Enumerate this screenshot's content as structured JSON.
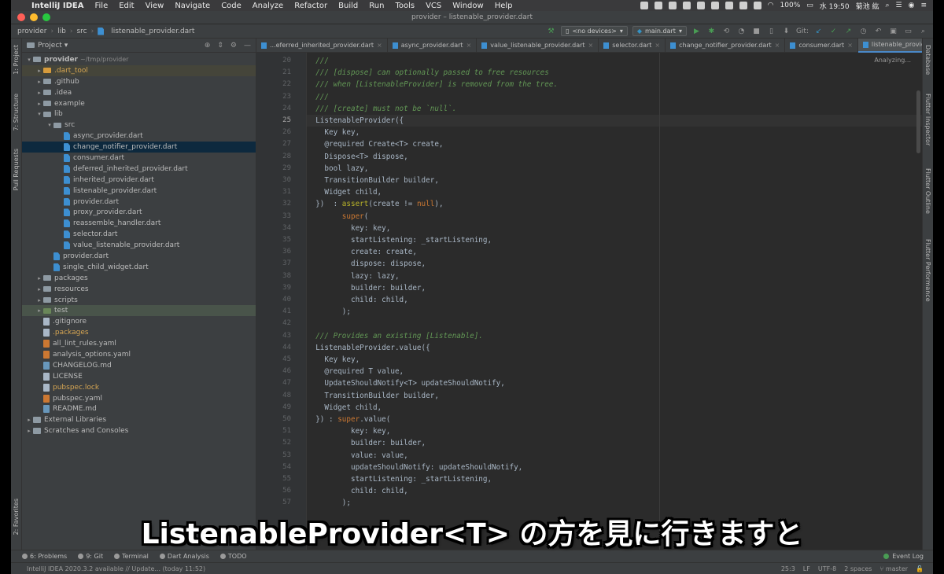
{
  "menubar": {
    "app": "IntelliJ IDEA",
    "items": [
      "File",
      "Edit",
      "View",
      "Navigate",
      "Code",
      "Analyze",
      "Refactor",
      "Build",
      "Run",
      "Tools",
      "VCS",
      "Window",
      "Help"
    ],
    "battery": "100%",
    "clock": "水 19:50",
    "user": "菊池 紘"
  },
  "window": {
    "title": "provider – listenable_provider.dart"
  },
  "breadcrumb": [
    "provider",
    "lib",
    "src",
    "listenable_provider.dart"
  ],
  "toolbar": {
    "device": "<no devices>",
    "run_config": "main.dart",
    "git_label": "Git:"
  },
  "project": {
    "header": "Project",
    "tree": [
      {
        "indent": 0,
        "arrow": "▾",
        "icon": "folder",
        "label": "provider",
        "suffix": "~/tmp/provider",
        "bold": true
      },
      {
        "indent": 1,
        "arrow": "▸",
        "icon": "folder-orange",
        "label": ".dart_tool",
        "style": "excluded"
      },
      {
        "indent": 1,
        "arrow": "▸",
        "icon": "folder",
        "label": ".github"
      },
      {
        "indent": 1,
        "arrow": "▸",
        "icon": "folder",
        "label": ".idea"
      },
      {
        "indent": 1,
        "arrow": "▸",
        "icon": "folder",
        "label": "example"
      },
      {
        "indent": 1,
        "arrow": "▾",
        "icon": "folder",
        "label": "lib"
      },
      {
        "indent": 2,
        "arrow": "▾",
        "icon": "folder",
        "label": "src"
      },
      {
        "indent": 3,
        "arrow": "",
        "icon": "dart",
        "label": "async_provider.dart"
      },
      {
        "indent": 3,
        "arrow": "",
        "icon": "dart",
        "label": "change_notifier_provider.dart",
        "style": "selected"
      },
      {
        "indent": 3,
        "arrow": "",
        "icon": "dart",
        "label": "consumer.dart"
      },
      {
        "indent": 3,
        "arrow": "",
        "icon": "dart",
        "label": "deferred_inherited_provider.dart"
      },
      {
        "indent": 3,
        "arrow": "",
        "icon": "dart",
        "label": "inherited_provider.dart"
      },
      {
        "indent": 3,
        "arrow": "",
        "icon": "dart",
        "label": "listenable_provider.dart"
      },
      {
        "indent": 3,
        "arrow": "",
        "icon": "dart",
        "label": "provider.dart"
      },
      {
        "indent": 3,
        "arrow": "",
        "icon": "dart",
        "label": "proxy_provider.dart"
      },
      {
        "indent": 3,
        "arrow": "",
        "icon": "dart",
        "label": "reassemble_handler.dart"
      },
      {
        "indent": 3,
        "arrow": "",
        "icon": "dart",
        "label": "selector.dart"
      },
      {
        "indent": 3,
        "arrow": "",
        "icon": "dart",
        "label": "value_listenable_provider.dart"
      },
      {
        "indent": 2,
        "arrow": "",
        "icon": "dart",
        "label": "provider.dart"
      },
      {
        "indent": 2,
        "arrow": "",
        "icon": "dart",
        "label": "single_child_widget.dart"
      },
      {
        "indent": 1,
        "arrow": "▸",
        "icon": "folder",
        "label": "packages"
      },
      {
        "indent": 1,
        "arrow": "▸",
        "icon": "folder",
        "label": "resources"
      },
      {
        "indent": 1,
        "arrow": "▸",
        "icon": "folder",
        "label": "scripts"
      },
      {
        "indent": 1,
        "arrow": "▸",
        "icon": "folder-green",
        "label": "test",
        "style": "test"
      },
      {
        "indent": 1,
        "arrow": "",
        "icon": "plain",
        "label": ".gitignore"
      },
      {
        "indent": 1,
        "arrow": "",
        "icon": "plain",
        "label": ".packages",
        "orange": true
      },
      {
        "indent": 1,
        "arrow": "",
        "icon": "yaml",
        "label": "all_lint_rules.yaml"
      },
      {
        "indent": 1,
        "arrow": "",
        "icon": "yaml",
        "label": "analysis_options.yaml"
      },
      {
        "indent": 1,
        "arrow": "",
        "icon": "md",
        "label": "CHANGELOG.md"
      },
      {
        "indent": 1,
        "arrow": "",
        "icon": "plain",
        "label": "LICENSE"
      },
      {
        "indent": 1,
        "arrow": "",
        "icon": "plain",
        "label": "pubspec.lock",
        "orange": true
      },
      {
        "indent": 1,
        "arrow": "",
        "icon": "yaml",
        "label": "pubspec.yaml"
      },
      {
        "indent": 1,
        "arrow": "",
        "icon": "md",
        "label": "README.md"
      },
      {
        "indent": 0,
        "arrow": "▸",
        "icon": "lib",
        "label": "External Libraries"
      },
      {
        "indent": 0,
        "arrow": "▸",
        "icon": "lib",
        "label": "Scratches and Consoles"
      }
    ]
  },
  "tabs": [
    {
      "label": "...eferred_inherited_provider.dart"
    },
    {
      "label": "async_provider.dart"
    },
    {
      "label": "value_listenable_provider.dart"
    },
    {
      "label": "selector.dart"
    },
    {
      "label": "change_notifier_provider.dart"
    },
    {
      "label": "consumer.dart"
    },
    {
      "label": "listenable_provider.dart",
      "active": true
    }
  ],
  "editor": {
    "status": "Analyzing...",
    "current_line": 25,
    "lines": [
      {
        "n": "20",
        "parts": [
          [
            "doc",
            "  ///"
          ]
        ]
      },
      {
        "n": "21",
        "parts": [
          [
            "doc",
            "  /// [dispose] can optionally passed to free resources"
          ]
        ]
      },
      {
        "n": "22",
        "parts": [
          [
            "doc",
            "  /// when [ListenableProvider] is removed from the tree."
          ]
        ]
      },
      {
        "n": "23",
        "parts": [
          [
            "doc",
            "  ///"
          ]
        ]
      },
      {
        "n": "24",
        "parts": [
          [
            "doc",
            "  /// [create] must not be `null`."
          ]
        ]
      },
      {
        "n": "25",
        "parts": [
          [
            "id",
            "  ListenableProvider({"
          ]
        ]
      },
      {
        "n": "26",
        "parts": [
          [
            "id",
            "    Key key,"
          ]
        ]
      },
      {
        "n": "27",
        "parts": [
          [
            "id",
            "    @required Create<T> create,"
          ]
        ]
      },
      {
        "n": "28",
        "parts": [
          [
            "id",
            "    Dispose<T> dispose,"
          ]
        ]
      },
      {
        "n": "29",
        "parts": [
          [
            "id",
            "    bool lazy,"
          ]
        ]
      },
      {
        "n": "30",
        "parts": [
          [
            "id",
            "    TransitionBuilder builder,"
          ]
        ]
      },
      {
        "n": "31",
        "parts": [
          [
            "id",
            "    Widget child,"
          ]
        ]
      },
      {
        "n": "32",
        "parts": [
          [
            "id",
            "  })  : "
          ],
          [
            "ann",
            "assert"
          ],
          [
            "id",
            "(create != "
          ],
          [
            "kw",
            "null"
          ],
          [
            "id",
            "),"
          ]
        ]
      },
      {
        "n": "33",
        "parts": [
          [
            "id",
            "        "
          ],
          [
            "kw",
            "super"
          ],
          [
            "id",
            "("
          ]
        ]
      },
      {
        "n": "34",
        "parts": [
          [
            "id",
            "          key: key,"
          ]
        ]
      },
      {
        "n": "35",
        "parts": [
          [
            "id",
            "          startListening: _startListening,"
          ]
        ]
      },
      {
        "n": "36",
        "parts": [
          [
            "id",
            "          create: create,"
          ]
        ]
      },
      {
        "n": "37",
        "parts": [
          [
            "id",
            "          dispose: dispose,"
          ]
        ]
      },
      {
        "n": "38",
        "parts": [
          [
            "id",
            "          lazy: lazy,"
          ]
        ]
      },
      {
        "n": "39",
        "parts": [
          [
            "id",
            "          builder: builder,"
          ]
        ]
      },
      {
        "n": "40",
        "parts": [
          [
            "id",
            "          child: child,"
          ]
        ]
      },
      {
        "n": "41",
        "parts": [
          [
            "id",
            "        );"
          ]
        ]
      },
      {
        "n": "42",
        "parts": [
          [
            "id",
            ""
          ]
        ]
      },
      {
        "n": "43",
        "parts": [
          [
            "doc",
            "  /// Provides an existing [Listenable]."
          ]
        ]
      },
      {
        "n": "44",
        "parts": [
          [
            "id",
            "  ListenableProvider.value({"
          ]
        ]
      },
      {
        "n": "45",
        "parts": [
          [
            "id",
            "    Key key,"
          ]
        ]
      },
      {
        "n": "46",
        "parts": [
          [
            "id",
            "    @required T value,"
          ]
        ]
      },
      {
        "n": "47",
        "parts": [
          [
            "id",
            "    UpdateShouldNotify<T> updateShouldNotify,"
          ]
        ]
      },
      {
        "n": "48",
        "parts": [
          [
            "id",
            "    TransitionBuilder builder,"
          ]
        ]
      },
      {
        "n": "49",
        "parts": [
          [
            "id",
            "    Widget child,"
          ]
        ]
      },
      {
        "n": "50",
        "parts": [
          [
            "id",
            "  }) : "
          ],
          [
            "kw",
            "super"
          ],
          [
            "id",
            ".value("
          ]
        ]
      },
      {
        "n": "51",
        "parts": [
          [
            "id",
            "          key: key,"
          ]
        ]
      },
      {
        "n": "52",
        "parts": [
          [
            "id",
            "          builder: builder,"
          ]
        ]
      },
      {
        "n": "53",
        "parts": [
          [
            "id",
            "          value: value,"
          ]
        ]
      },
      {
        "n": "54",
        "parts": [
          [
            "id",
            "          updateShouldNotify: updateShouldNotify,"
          ]
        ]
      },
      {
        "n": "55",
        "parts": [
          [
            "id",
            "          startListening: _startListening,"
          ]
        ]
      },
      {
        "n": "56",
        "parts": [
          [
            "id",
            "          child: child,"
          ]
        ]
      },
      {
        "n": "57",
        "parts": [
          [
            "id",
            "        );"
          ]
        ]
      }
    ]
  },
  "left_strip": [
    "1: Project",
    "7: Structure",
    "Pull Requests",
    "2: Favorites"
  ],
  "right_strip": [
    "Database",
    "Flutter Inspector",
    "Flutter Outline",
    "Flutter Performance"
  ],
  "bottom_tools": [
    "6: Problems",
    "9: Git",
    "Terminal",
    "Dart Analysis",
    "TODO"
  ],
  "event_log": "Event Log",
  "status": {
    "message": "IntelliJ IDEA 2020.3.2 available // Update... (today 11:52)",
    "position": "25:3",
    "line_sep": "LF",
    "encoding": "UTF-8",
    "indent": "2 spaces",
    "branch": "master"
  },
  "subtitle": "ListenableProvider<T> の方を見に行きますと"
}
